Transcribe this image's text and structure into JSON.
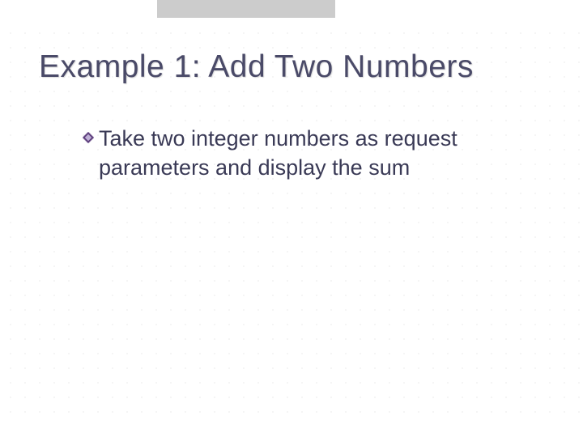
{
  "slide": {
    "title": "Example 1: Add Two Numbers",
    "bullets": [
      {
        "text": "Take two integer numbers as request parameters and display the sum"
      }
    ]
  }
}
